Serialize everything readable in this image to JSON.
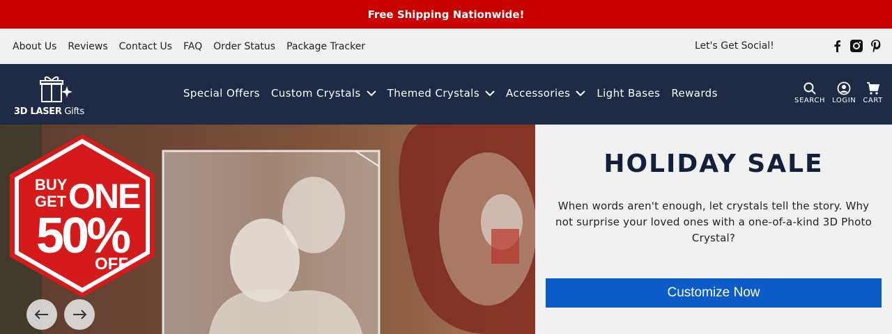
{
  "promo": {
    "text": "Free Shipping Nationwide!"
  },
  "utility_nav": {
    "links": [
      "About Us",
      "Reviews",
      "Contact Us",
      "FAQ",
      "Order Status",
      "Package Tracker"
    ],
    "social_label": "Let's Get Social!",
    "social_icons": [
      "facebook-icon",
      "instagram-icon",
      "pinterest-icon"
    ]
  },
  "header": {
    "logo_brand": "3D LASER",
    "logo_suffix": "Gifts",
    "menu": [
      {
        "label": "Special Offers",
        "dropdown": false
      },
      {
        "label": "Custom Crystals",
        "dropdown": true
      },
      {
        "label": "Themed Crystals",
        "dropdown": true
      },
      {
        "label": "Accessories",
        "dropdown": true
      },
      {
        "label": "Light Bases",
        "dropdown": false
      },
      {
        "label": "Rewards",
        "dropdown": false
      }
    ],
    "actions": {
      "search": "SEARCH",
      "login": "LOGIN",
      "cart": "CART"
    }
  },
  "hero": {
    "badge": {
      "line1": "BUY",
      "line2": "GET",
      "line3": "ONE",
      "percent": "50%",
      "off": "OFF"
    },
    "title": "HOLIDAY SALE",
    "description": "When words aren't enough, let crystals tell the story. Why not surprise your loved ones with a one-of-a-kind 3D Photo Crystal?",
    "cta": "Customize Now"
  },
  "colors": {
    "promo_red": "#c80000",
    "nav_navy": "#1e2a46",
    "cta_blue": "#0b5cc8",
    "badge_red": "#d41a1a"
  }
}
